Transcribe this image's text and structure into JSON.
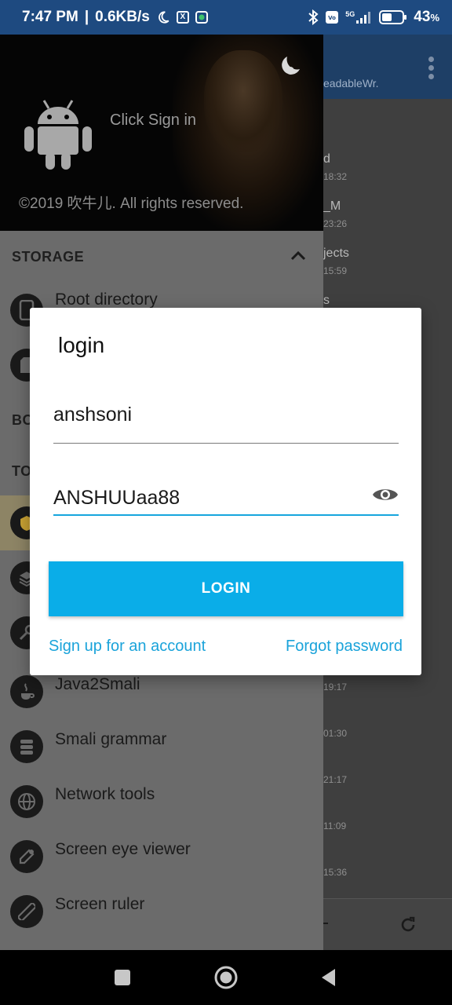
{
  "status_bar": {
    "time": "7:47 PM",
    "speed": "0.6KB/s",
    "network": "5G",
    "battery": "43",
    "battery_unit": "%"
  },
  "background_app": {
    "subtitle": "eadableWr.",
    "items": [
      {
        "name": "d",
        "time": "18:32"
      },
      {
        "name": "_M",
        "time": "23:26"
      },
      {
        "name": "jects",
        "time": "15:59"
      },
      {
        "name": "s",
        "time": ""
      },
      {
        "name": "",
        "time": "19:17"
      },
      {
        "name": "",
        "time": "01:30"
      },
      {
        "name": "",
        "time": "21:17"
      },
      {
        "name": "",
        "time": "11:09"
      },
      {
        "name": "",
        "time": "15:36"
      }
    ]
  },
  "drawer": {
    "header": {
      "sign_in": "Click Sign in",
      "copyright": "©2019 吹牛儿. All rights reserved."
    },
    "sections": {
      "storage": "STORAGE",
      "bookmarks_partial": "BO",
      "tools_partial": "TO"
    },
    "items": [
      {
        "label": "Root directory",
        "icon": "phone-icon"
      },
      {
        "label": "",
        "icon": "sd-card-icon"
      },
      {
        "label": "",
        "icon": "tool-icon"
      },
      {
        "label": "",
        "icon": "layers-icon"
      },
      {
        "label": "",
        "icon": "key-icon"
      },
      {
        "label": "Java2Smali",
        "icon": "java-icon"
      },
      {
        "label": "Smali grammar",
        "icon": "database-icon"
      },
      {
        "label": "Network tools",
        "icon": "globe-icon"
      },
      {
        "label": "Screen eye viewer",
        "icon": "eyedropper-icon"
      },
      {
        "label": "Screen ruler",
        "icon": "ruler-icon"
      }
    ]
  },
  "dialog": {
    "title": "login",
    "username": "anshsoni",
    "password": "ANSHUUaa88",
    "login_button": "LOGIN",
    "signup_link": "Sign up for an account",
    "forgot_link": "Forgot password"
  },
  "colors": {
    "accent": "#0aade8",
    "link": "#1aa3da",
    "status_bar": "#1e4a80"
  }
}
